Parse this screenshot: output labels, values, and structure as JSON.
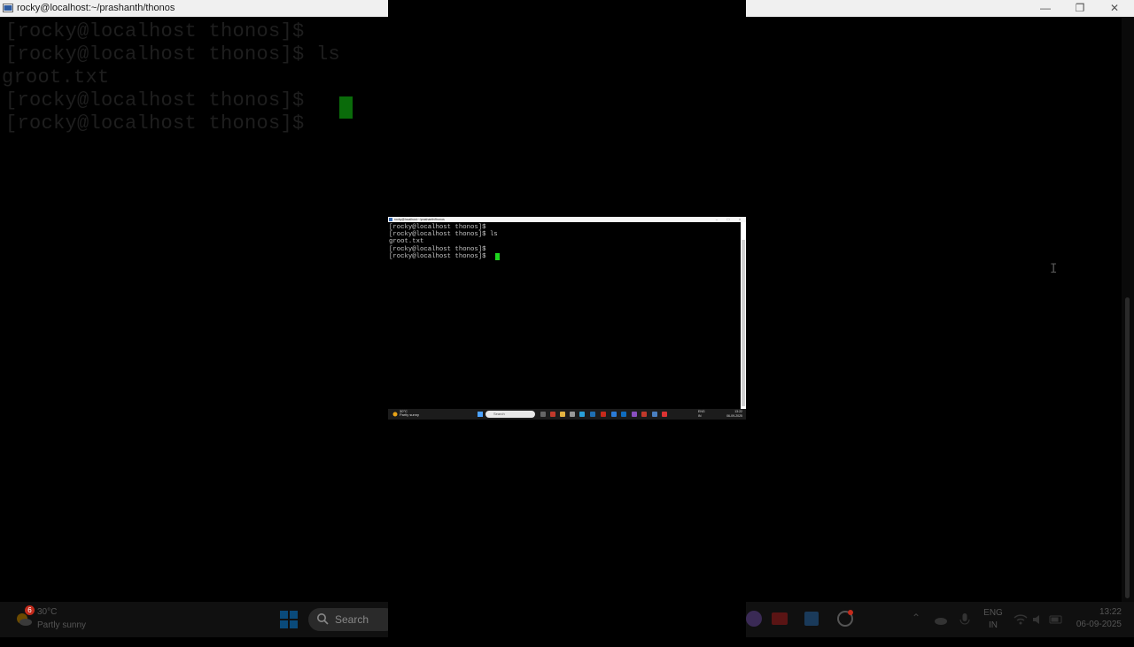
{
  "background": {
    "title": "rocky@localhost:~/prashanth/thonos",
    "terminal_lines": [
      "[rocky@localhost thonos]$",
      "[rocky@localhost thonos]$ ls",
      "groot.txt",
      "[rocky@localhost thonos]$",
      "[rocky@localhost thonos]$ "
    ],
    "taskbar": {
      "weather_badge": "6",
      "weather_temp": "30°C",
      "weather_desc": "Partly sunny",
      "search_placeholder": "Search",
      "lang_line1": "ENG",
      "lang_line2": "IN",
      "time": "13:22",
      "date": "06-09-2025"
    },
    "colors": {
      "cursor": "#0a6b0a",
      "text": "#1e1e1e",
      "taskbar": "#101010"
    }
  },
  "recording": {
    "window_title": "rocky@localhost:~/prashanth/thonos",
    "terminal_lines": [
      "[rocky@localhost thonos]$",
      "[rocky@localhost thonos]$ ls",
      "groot.txt",
      "[rocky@localhost thonos]$",
      "[rocky@localhost thonos]$ "
    ],
    "taskbar": {
      "weather_temp": "30°C",
      "weather_desc": "Partly sunny",
      "search_placeholder": "Search",
      "lang_line1": "ENG",
      "lang_line2": "IN",
      "time": "13:22",
      "date": "06-09-2025"
    },
    "colors": {
      "cursor": "#1ed61e",
      "text": "#c8c8c8"
    }
  }
}
